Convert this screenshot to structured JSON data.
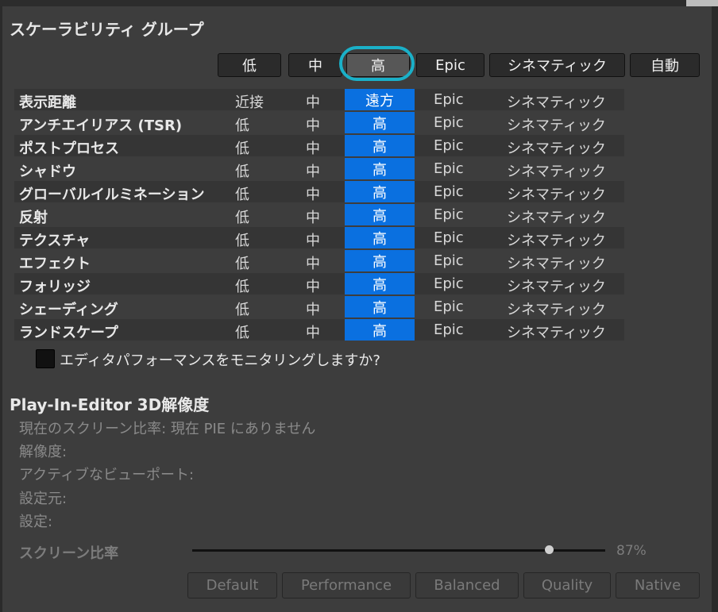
{
  "scalability": {
    "title": "スケーラビリティ グループ",
    "buttons": [
      {
        "label": "低",
        "active": false
      },
      {
        "label": "中",
        "active": false
      },
      {
        "label": "高",
        "active": true
      },
      {
        "label": "Epic",
        "active": false
      },
      {
        "label": "シネマティック",
        "active": false
      },
      {
        "label": "自動",
        "active": false
      }
    ],
    "rows": [
      {
        "name": "表示距離",
        "low": "近接",
        "mid": "中",
        "high": "遠方",
        "epic": "Epic",
        "cine": "シネマティック"
      },
      {
        "name": "アンチエイリアス (TSR)",
        "low": "低",
        "mid": "中",
        "high": "高",
        "epic": "Epic",
        "cine": "シネマティック"
      },
      {
        "name": "ポストプロセス",
        "low": "低",
        "mid": "中",
        "high": "高",
        "epic": "Epic",
        "cine": "シネマティック"
      },
      {
        "name": "シャドウ",
        "low": "低",
        "mid": "中",
        "high": "高",
        "epic": "Epic",
        "cine": "シネマティック"
      },
      {
        "name": "グローバルイルミネーション",
        "low": "低",
        "mid": "中",
        "high": "高",
        "epic": "Epic",
        "cine": "シネマティック"
      },
      {
        "name": "反射",
        "low": "低",
        "mid": "中",
        "high": "高",
        "epic": "Epic",
        "cine": "シネマティック"
      },
      {
        "name": "テクスチャ",
        "low": "低",
        "mid": "中",
        "high": "高",
        "epic": "Epic",
        "cine": "シネマティック"
      },
      {
        "name": "エフェクト",
        "low": "低",
        "mid": "中",
        "high": "高",
        "epic": "Epic",
        "cine": "シネマティック"
      },
      {
        "name": "フォリッジ",
        "low": "低",
        "mid": "中",
        "high": "高",
        "epic": "Epic",
        "cine": "シネマティック"
      },
      {
        "name": "シェーディング",
        "low": "低",
        "mid": "中",
        "high": "高",
        "epic": "Epic",
        "cine": "シネマティック"
      },
      {
        "name": "ランドスケープ",
        "low": "低",
        "mid": "中",
        "high": "高",
        "epic": "Epic",
        "cine": "シネマティック"
      }
    ],
    "monitor_checkbox": {
      "label": "エディタパフォーマンスをモニタリングしますか?",
      "checked": false
    }
  },
  "pie": {
    "title": "Play-In-Editor 3D解像度",
    "screen_ratio_line": "現在のスクリーン比率: 現在 PIE にありません",
    "resolution_label": "解像度:",
    "active_viewport_label": "アクティブなビューポート:",
    "source_label": "設定元:",
    "setting_label": "設定:",
    "slider": {
      "label": "スクリーン比率",
      "value": 0.87,
      "value_text": "87%"
    },
    "presets": [
      "Default",
      "Performance",
      "Balanced",
      "Quality",
      "Native"
    ]
  },
  "colors": {
    "selected": "#0a70e0",
    "ring": "#1ab0c8",
    "panel": "#3d3d3d"
  }
}
